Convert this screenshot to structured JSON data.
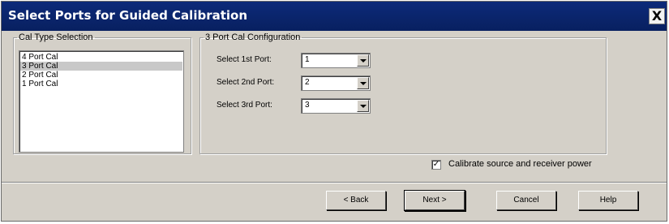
{
  "window": {
    "title": "Select Ports for Guided Calibration",
    "close_label": "X"
  },
  "cal_type": {
    "legend": "Cal Type Selection",
    "items": [
      "4 Port Cal",
      "3 Port Cal",
      "2 Port Cal",
      "1 Port Cal"
    ],
    "selected": "3 Port Cal"
  },
  "port_config": {
    "legend": "3 Port Cal Configuration",
    "rows": [
      {
        "label": "Select 1st Port:",
        "value": "1"
      },
      {
        "label": "Select 2nd Port:",
        "value": "2"
      },
      {
        "label": "Select 3rd Port:",
        "value": "3"
      }
    ]
  },
  "checkbox": {
    "label": "Calibrate source and receiver power",
    "checked": true,
    "mark": "✓"
  },
  "buttons": {
    "back": "< Back",
    "next": "Next >",
    "cancel": "Cancel",
    "help": "Help"
  },
  "icons": {
    "close": "close-icon",
    "dropdown": "chevron-down-icon",
    "check": "check-icon"
  },
  "colors": {
    "title_bar": "#0a246a",
    "dialog_bg": "#d4d0c8",
    "list_selected": "#c8c8c8"
  }
}
